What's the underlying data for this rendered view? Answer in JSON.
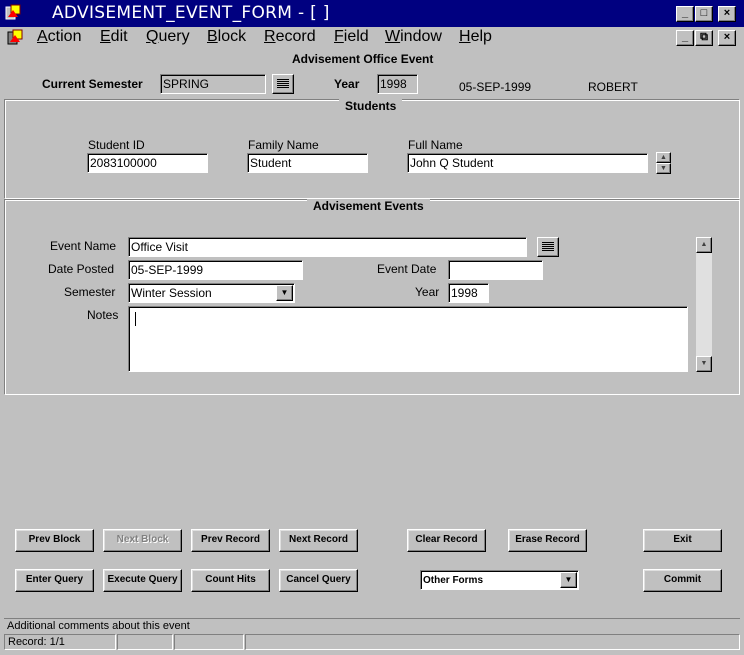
{
  "window": {
    "title": "ADVISEMENT_EVENT_FORM - [ ]",
    "controls": {
      "minimize": "_",
      "maximize": "□",
      "close": "×",
      "restore": "⧉"
    }
  },
  "menu": [
    "Action",
    "Edit",
    "Query",
    "Block",
    "Record",
    "Field",
    "Window",
    "Help"
  ],
  "menu_underline": [
    "A",
    "E",
    "Q",
    "B",
    "R",
    "F",
    "W",
    "H"
  ],
  "header": {
    "title": "Advisement Office Event",
    "current_semester_label": "Current Semester",
    "current_semester_value": "SPRING",
    "year_label": "Year",
    "year_value": "1998",
    "date": "05-SEP-1999",
    "user": "ROBERT"
  },
  "students": {
    "title": "Students",
    "student_id_label": "Student ID",
    "student_id_value": "2083100000",
    "family_name_label": "Family Name",
    "family_name_value": "Student",
    "full_name_label": "Full Name",
    "full_name_value": "John Q Student"
  },
  "events": {
    "title": "Advisement Events",
    "event_name_label": "Event Name",
    "event_name_value": "Office Visit",
    "date_posted_label": "Date Posted",
    "date_posted_value": "05-SEP-1999",
    "event_date_label": "Event Date",
    "event_date_value": "",
    "semester_label": "Semester",
    "semester_value": "Winter Session",
    "year_label": "Year",
    "year_value": "1998",
    "notes_label": "Notes",
    "notes_value": ""
  },
  "buttons": {
    "prev_block": "Prev Block",
    "next_block": "Next Block",
    "prev_record": "Prev Record",
    "next_record": "Next Record",
    "clear_record": "Clear Record",
    "erase_record": "Erase Record",
    "exit": "Exit",
    "enter_query": "Enter Query",
    "execute_query": "Execute Query",
    "count_hits": "Count Hits",
    "cancel_query": "Cancel Query",
    "commit": "Commit"
  },
  "other_forms": {
    "selected": "Other Forms"
  },
  "status": {
    "message": "Additional comments about this event",
    "record": "Record: 1/1"
  },
  "colors": {
    "titlebar": "#000080",
    "face": "#c0c0c0",
    "field": "#ffffff"
  }
}
